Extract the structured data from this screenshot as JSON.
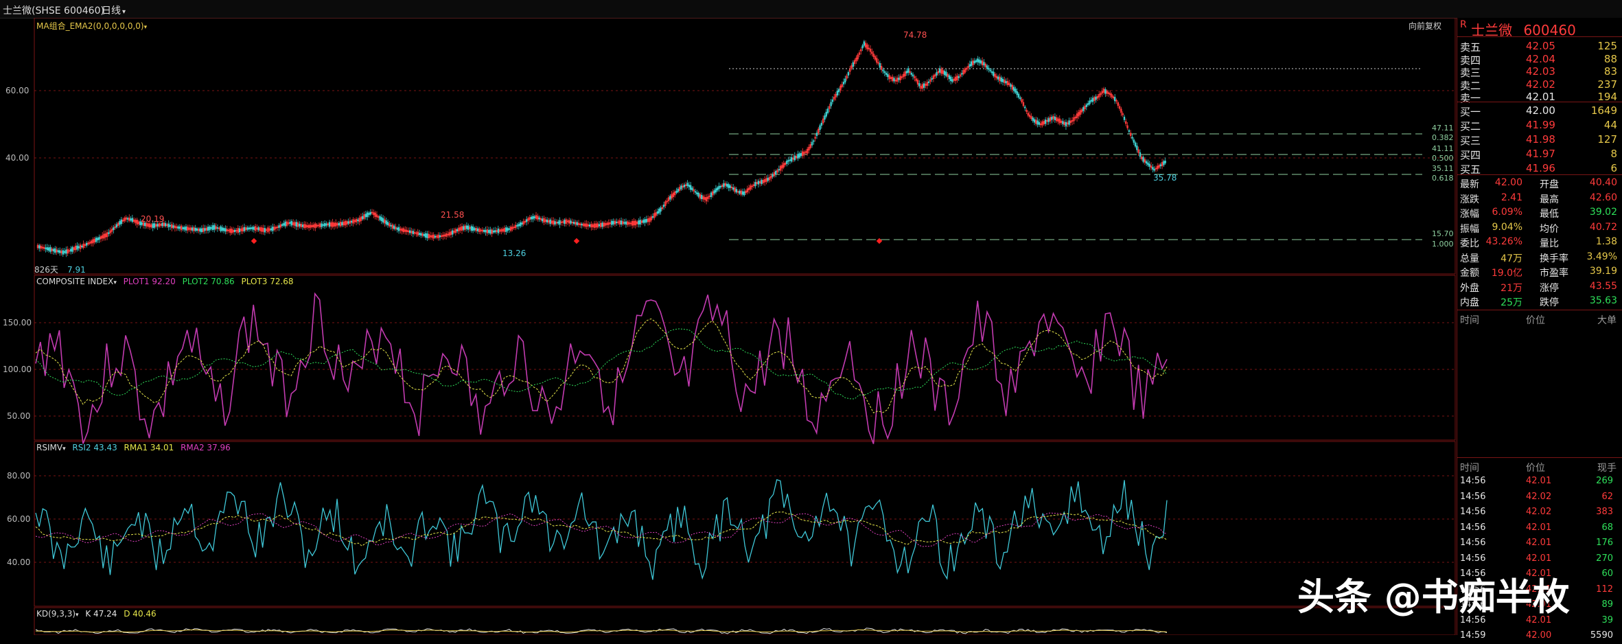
{
  "topbar": {
    "stock": "士兰微(SHSE 600460)",
    "period": "日线",
    "icon_chevron": "chevron-down-icon"
  },
  "price_panel": {
    "indicator": "MA组合_EMA2(0,0,0,0,0,0)",
    "adjust": "向前复权",
    "y_ticks": [
      "60.00",
      "40.00"
    ],
    "annotations": {
      "high": "74.78",
      "low_recent": "35.78",
      "p1": "20.19",
      "p2": "21.58",
      "p3": "13.26",
      "p4": "7.91",
      "days": "826天"
    },
    "fib_levels": [
      "47.11",
      "0.382",
      "41.11",
      "0.500",
      "35.11",
      "0.618",
      "15.70",
      "1.000"
    ],
    "close_series": [
      10,
      9.5,
      9,
      8.5,
      8,
      8.5,
      9.5,
      10,
      11,
      12,
      13,
      14,
      16,
      18,
      19.5,
      19,
      18,
      17.5,
      17,
      17.2,
      17.5,
      17,
      16.5,
      16.2,
      16,
      15.8,
      15.5,
      16,
      16.5,
      16,
      15.5,
      15.2,
      15.5,
      16,
      16.2,
      16,
      15.5,
      15.8,
      16.5,
      17.5,
      18,
      17.5,
      17,
      16.8,
      17,
      17.2,
      17.5,
      17.4,
      17.6,
      18,
      18.5,
      19,
      20.5,
      21.5,
      20,
      18.5,
      17,
      16,
      15.5,
      15,
      14.5,
      14,
      13.5,
      13.3,
      13.5,
      14,
      15,
      16,
      16.5,
      16,
      15.5,
      15.2,
      15,
      15.3,
      15.6,
      16,
      17,
      18,
      19.5,
      20,
      19,
      18.5,
      18,
      18.2,
      18.5,
      18,
      17.5,
      17.2,
      17,
      17.2,
      17.5,
      18,
      18.2,
      18,
      17.8,
      18,
      18.5,
      19,
      21,
      23,
      26,
      28,
      30,
      31,
      29,
      27,
      26,
      28,
      30,
      31,
      30,
      28.5,
      28,
      30,
      31.5,
      32,
      33,
      35,
      37,
      39,
      40,
      41,
      42,
      45,
      49,
      53,
      57,
      60,
      63,
      67,
      70,
      74,
      72,
      69,
      66,
      64,
      63,
      64,
      66,
      64,
      61,
      62,
      64,
      66,
      65,
      63,
      64,
      66,
      68,
      69,
      68,
      66,
      64,
      63,
      62,
      60,
      57,
      53,
      51,
      50,
      51,
      52,
      51,
      50,
      51,
      53,
      55,
      57,
      58,
      60,
      59,
      57,
      53,
      48,
      44,
      40,
      38,
      36,
      37.5,
      39
    ]
  },
  "composite_panel": {
    "title": "COMPOSITE INDEX",
    "plot1": "PLOT1 92.20",
    "plot2": "PLOT2 70.86",
    "plot3": "PLOT3 72.68",
    "y_ticks": [
      "150.00",
      "100.00",
      "50.00"
    ]
  },
  "rsi_panel": {
    "title": "RSIMV",
    "rsi2": "RSI2 43.43",
    "rma1": "RMA1 34.01",
    "rma2": "RMA2 37.96",
    "y_ticks": [
      "80.00",
      "60.00",
      "40.00"
    ]
  },
  "kd_panel": {
    "title": "KD(9,3,3)",
    "k": "K 47.24",
    "d": "D 40.46"
  },
  "quote": {
    "name": "士兰微",
    "code": "600460",
    "marker": "R",
    "asks": [
      {
        "label": "卖五",
        "price": "42.05",
        "vol": "125"
      },
      {
        "label": "卖四",
        "price": "42.04",
        "vol": "88"
      },
      {
        "label": "卖三",
        "price": "42.03",
        "vol": "83"
      },
      {
        "label": "卖二",
        "price": "42.02",
        "vol": "237"
      },
      {
        "label": "卖一",
        "price": "42.01",
        "vol": "194"
      }
    ],
    "bids": [
      {
        "label": "买一",
        "price": "42.00",
        "vol": "1649"
      },
      {
        "label": "买二",
        "price": "41.99",
        "vol": "44"
      },
      {
        "label": "买三",
        "price": "41.98",
        "vol": "127"
      },
      {
        "label": "买四",
        "price": "41.97",
        "vol": "8"
      },
      {
        "label": "买五",
        "price": "41.96",
        "vol": "6"
      }
    ],
    "stats": [
      {
        "l1": "最新",
        "v1": "42.00",
        "c1": "red",
        "l2": "开盘",
        "v2": "40.40",
        "c2": "red"
      },
      {
        "l1": "涨跌",
        "v1": "2.41",
        "c1": "red",
        "l2": "最高",
        "v2": "42.60",
        "c2": "red"
      },
      {
        "l1": "涨幅",
        "v1": "6.09%",
        "c1": "red",
        "l2": "最低",
        "v2": "39.02",
        "c2": "green"
      },
      {
        "l1": "振幅",
        "v1": "9.04%",
        "c1": "yellow",
        "l2": "均价",
        "v2": "40.72",
        "c2": "red"
      },
      {
        "l1": "委比",
        "v1": "43.26%",
        "c1": "red",
        "l2": "量比",
        "v2": "1.38",
        "c2": "yellow"
      },
      {
        "l1": "总量",
        "v1": "47万",
        "c1": "yellow",
        "l2": "换手率",
        "v2": "3.49%",
        "c2": "yellow"
      },
      {
        "l1": "金额",
        "v1": "19.0亿",
        "c1": "red",
        "l2": "市盈率",
        "v2": "39.19",
        "c2": "yellow"
      },
      {
        "l1": "外盘",
        "v1": "21万",
        "c1": "red",
        "l2": "涨停",
        "v2": "43.55",
        "c2": "red"
      },
      {
        "l1": "内盘",
        "v1": "25万",
        "c1": "green",
        "l2": "跌停",
        "v2": "35.63",
        "c2": "green"
      }
    ],
    "big_orders_header": {
      "time": "时间",
      "price": "价位",
      "big": "大单"
    },
    "ticks_header": {
      "time": "时间",
      "price": "价位",
      "vol": "现手"
    },
    "ticks": [
      {
        "time": "14:56",
        "price": "42.01",
        "vol": "269",
        "pc": "red",
        "vc": "green"
      },
      {
        "time": "14:56",
        "price": "42.02",
        "vol": "62",
        "pc": "red",
        "vc": "red"
      },
      {
        "time": "14:56",
        "price": "42.02",
        "vol": "383",
        "pc": "red",
        "vc": "red"
      },
      {
        "time": "14:56",
        "price": "42.01",
        "vol": "68",
        "pc": "red",
        "vc": "green"
      },
      {
        "time": "14:56",
        "price": "42.01",
        "vol": "176",
        "pc": "red",
        "vc": "green"
      },
      {
        "time": "14:56",
        "price": "42.01",
        "vol": "270",
        "pc": "red",
        "vc": "green"
      },
      {
        "time": "14:56",
        "price": "42.01",
        "vol": "60",
        "pc": "red",
        "vc": "green"
      },
      {
        "time": "14:56",
        "price": "42.01",
        "vol": "112",
        "pc": "red",
        "vc": "red"
      },
      {
        "time": "14:56",
        "price": "42.01",
        "vol": "89",
        "pc": "red",
        "vc": "green"
      },
      {
        "time": "14:56",
        "price": "42.01",
        "vol": "39",
        "pc": "red",
        "vc": "green"
      },
      {
        "time": "14:59",
        "price": "42.00",
        "vol": "5590",
        "pc": "red",
        "vc": "white"
      }
    ]
  },
  "watermark": "头条 @书痴半枚",
  "colors": {
    "bg": "#000000",
    "grid_red": "#7a1515",
    "up": "#ff3b3b",
    "down": "#2ee05a",
    "composite": "#c23bb0",
    "rsi": "#3fc8d8",
    "signal": "#e6e64a",
    "fib": "#8fd0a0"
  }
}
